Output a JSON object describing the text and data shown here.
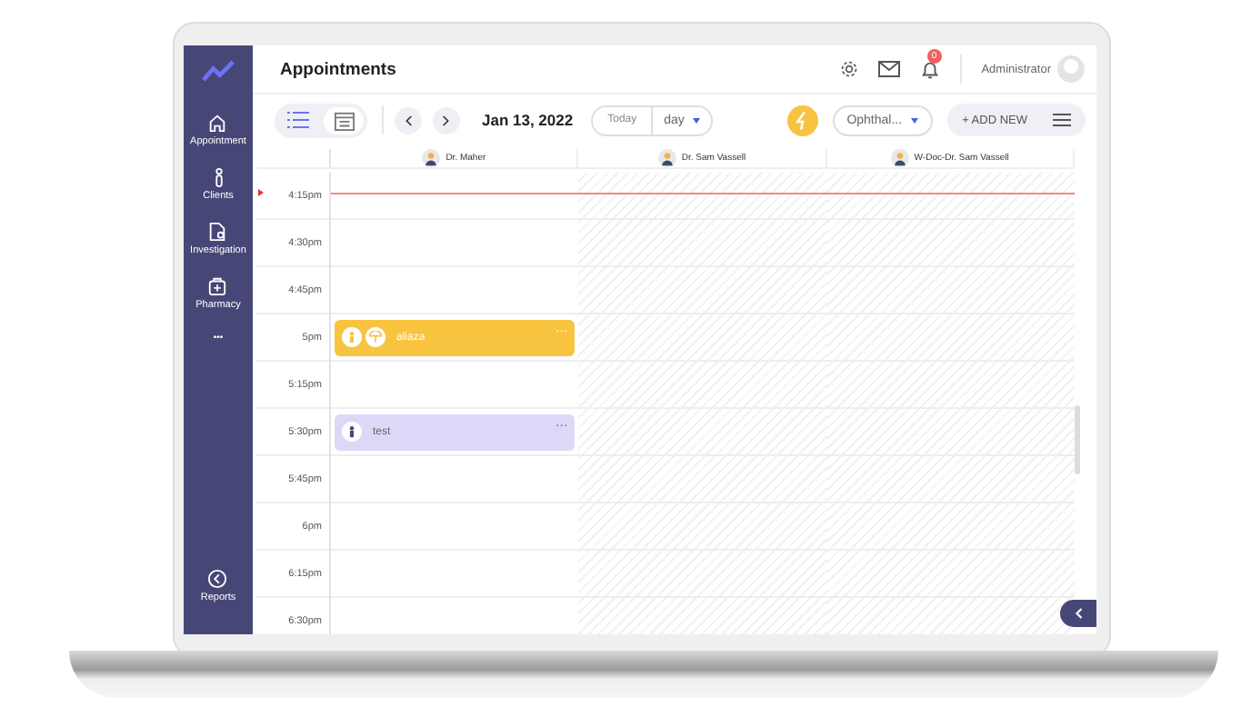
{
  "sidebar": {
    "items": [
      {
        "label": "Appointment"
      },
      {
        "label": "Clients"
      },
      {
        "label": "Investigation"
      },
      {
        "label": "Pharmacy"
      }
    ],
    "more": "•••",
    "footer": {
      "label": "Reports"
    }
  },
  "header": {
    "title": "Appointments",
    "notifications": "0",
    "user": "Administrator"
  },
  "toolbar": {
    "views": [
      {
        "kind": "list",
        "selected": false
      },
      {
        "kind": "calendar",
        "selected": true
      }
    ],
    "date": "Jan 13, 2022",
    "today": "Today",
    "range": "day",
    "specialty": "Ophthal...",
    "add": "+ ADD NEW"
  },
  "columns": [
    {
      "name": "Dr. Maher",
      "available": true
    },
    {
      "name": "Dr. Sam Vassell",
      "available": false
    },
    {
      "name": "W-Doc-Dr. Sam Vassell",
      "available": false
    }
  ],
  "time_slots": [
    {
      "label": "4:15pm"
    },
    {
      "label": "4:30pm"
    },
    {
      "label": "4:45pm"
    },
    {
      "label": "5pm",
      "appointments": [
        {
          "name": "aliaza",
          "menu": "···",
          "color": "#f8c440",
          "kind": "group"
        }
      ]
    },
    {
      "label": "5:15pm"
    },
    {
      "label": "5:30pm",
      "appointments": [
        {
          "name": "test",
          "menu": "···",
          "color": "#dcd9f8",
          "kind": "individual"
        }
      ]
    },
    {
      "label": "5:45pm"
    },
    {
      "label": "6pm"
    },
    {
      "label": "6:15pm"
    },
    {
      "label": "6:30pm"
    }
  ]
}
